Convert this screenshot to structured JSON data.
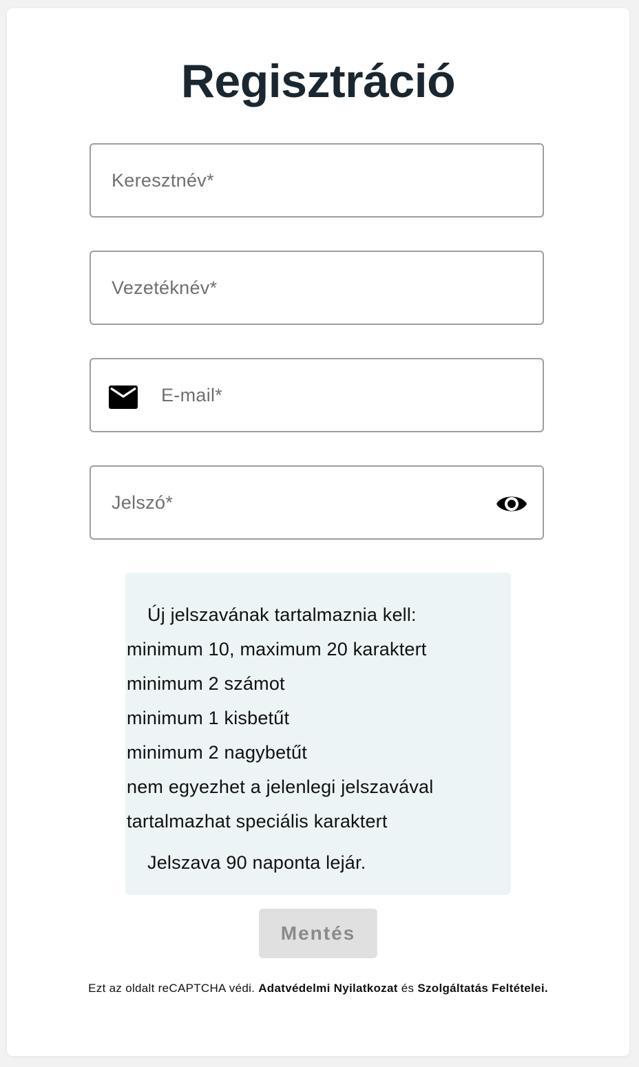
{
  "page": {
    "title": "Regisztráció"
  },
  "form": {
    "first_name": {
      "value": "",
      "placeholder": "Keresztnév*"
    },
    "last_name": {
      "value": "",
      "placeholder": "Vezetéknév*"
    },
    "email": {
      "value": "",
      "placeholder": "E-mail*",
      "icon": "mail-icon"
    },
    "password": {
      "value": "",
      "placeholder": "Jelszó*",
      "toggle_icon": "eye-icon"
    }
  },
  "password_rules": {
    "heading": "Új jelszavának tartalmaznia kell:",
    "items": [
      {
        "text": "minimum 10, maximum 20 karaktert"
      },
      {
        "text": "minimum 2 számot"
      },
      {
        "text": "minimum 1 kisbetűt"
      },
      {
        "text": "minimum 2 nagybetűt"
      },
      {
        "text": "nem egyezhet a jelenlegi jelszavával"
      },
      {
        "text": "tartalmazhat speciális karaktert"
      }
    ],
    "note": "Jelszava 90 naponta lejár."
  },
  "actions": {
    "save_label": "Mentés",
    "save_enabled": false
  },
  "footer": {
    "prefix": "Ezt az oldalt reCAPTCHA védi.",
    "privacy_link": "Adatvédelmi Nyilatkozat",
    "conjunction": "és",
    "terms_link": "Szolgáltatás Feltételei."
  },
  "colors": {
    "title": "#1b2730",
    "info_background": "#edf4f6",
    "button_disabled_bg": "#e0e0e0",
    "button_disabled_text": "#8a8a8a",
    "field_border": "#9e9e9e"
  }
}
